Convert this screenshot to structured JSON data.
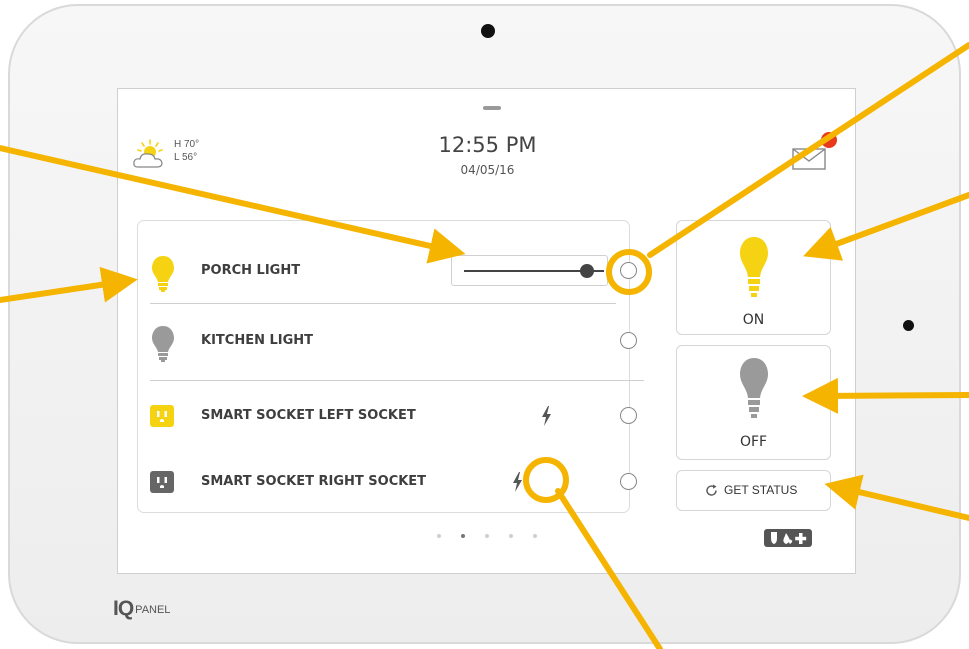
{
  "header": {
    "weather_high": "H 70°",
    "weather_low": "L 56°",
    "time": "12:55 PM",
    "date": "04/05/16"
  },
  "devices": [
    {
      "label": "PORCH LIGHT",
      "type": "light",
      "state": "on",
      "dimmer_level": 0.88
    },
    {
      "label": "KITCHEN LIGHT",
      "type": "light",
      "state": "off"
    },
    {
      "label": "SMART SOCKET LEFT SOCKET",
      "type": "socket",
      "state": "on"
    },
    {
      "label": "SMART SOCKET RIGHT SOCKET",
      "type": "socket",
      "state": "off"
    }
  ],
  "tiles": {
    "on_label": "ON",
    "off_label": "OFF",
    "status_label": "GET STATUS"
  },
  "pager": {
    "pages": 5,
    "active": 2
  },
  "logo": {
    "mark": "IQ",
    "text": "PANEL"
  },
  "colors": {
    "accent_yellow": "#f5d312",
    "bulb_off_gray": "#9a9a9a",
    "socket_off_gray": "#666666",
    "arrow_orange": "#f5b400",
    "badge_red": "#e8391c"
  },
  "icons": [
    "weather-sun-cloud-icon",
    "mail-icon",
    "bulb-icon",
    "socket-icon",
    "bolt-icon",
    "refresh-icon",
    "emergency-icon"
  ]
}
